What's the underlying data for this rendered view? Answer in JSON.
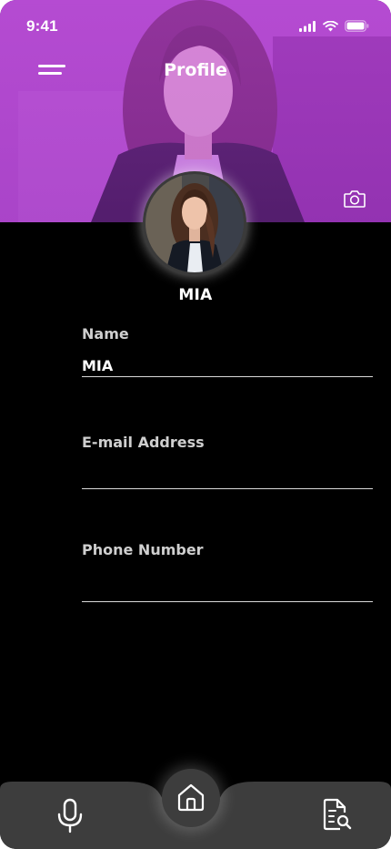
{
  "status_bar": {
    "time": "9:41",
    "icons": [
      "signal-icon",
      "wifi-icon",
      "battery-icon"
    ]
  },
  "header": {
    "title": "Profile",
    "menu_icon": "menu-icon",
    "camera_icon": "camera-icon"
  },
  "profile": {
    "display_name": "MIA"
  },
  "form": {
    "name": {
      "label": "Name",
      "value": "MIA",
      "placeholder": ""
    },
    "email": {
      "label": "E-mail Address",
      "value": "",
      "placeholder": ""
    },
    "phone": {
      "label": "Phone Number",
      "value": "",
      "placeholder": ""
    }
  },
  "bottom_nav": {
    "items": [
      "microphone-icon",
      "home-icon",
      "document-search-icon"
    ]
  },
  "colors": {
    "background": "#000000",
    "cover_tint": "#a23dbf",
    "nav_background": "#3d3d3d",
    "text_primary": "#ffffff",
    "text_label": "#cfcfcf"
  }
}
